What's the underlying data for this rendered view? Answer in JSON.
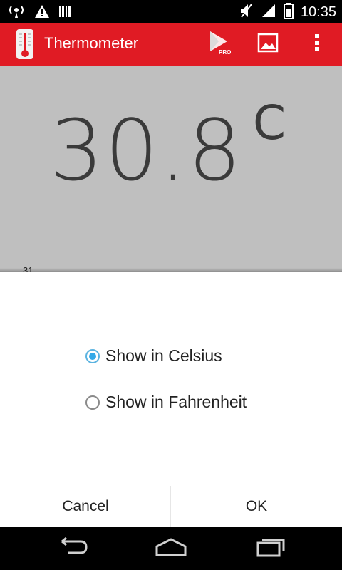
{
  "status_bar": {
    "time": "10:35",
    "icons": [
      "hotspot-icon",
      "warning-icon",
      "barcode-icon",
      "mute-icon",
      "signal-icon",
      "battery-icon"
    ]
  },
  "app_bar": {
    "title": "Thermometer",
    "pro_badge": "PRO",
    "actions": [
      "pro-store-icon",
      "image-icon",
      "overflow-menu-icon"
    ],
    "color": "#e01b24"
  },
  "main": {
    "reading": "30.8",
    "unit": "C",
    "tick_label": "31"
  },
  "dialog": {
    "options": [
      {
        "label": "Show in Celsius",
        "selected": true
      },
      {
        "label": "Show in Fahrenheit",
        "selected": false
      }
    ],
    "cancel_label": "Cancel",
    "ok_label": "OK",
    "accent": "#33a9e8"
  },
  "nav_bar": {
    "buttons": [
      "back-icon",
      "home-icon",
      "recents-icon"
    ]
  }
}
